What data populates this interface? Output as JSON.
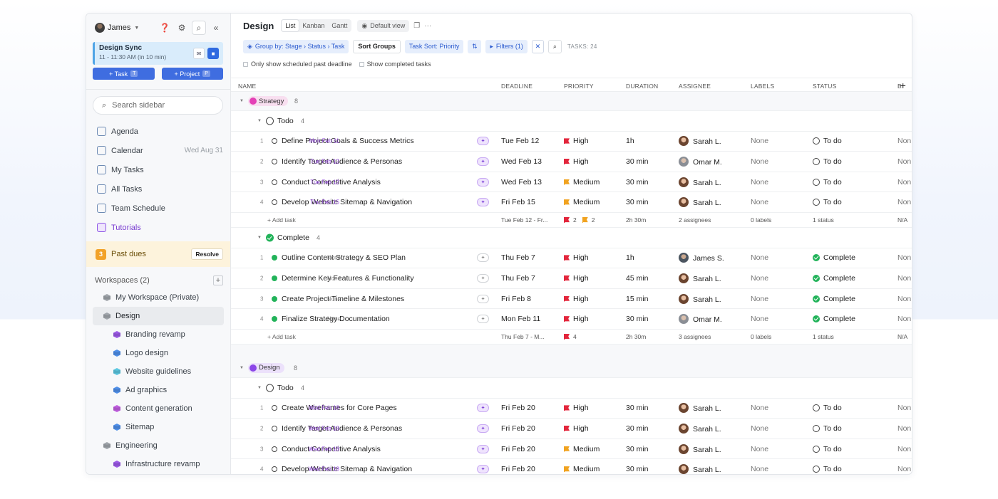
{
  "sidebar": {
    "user": "James",
    "meeting": {
      "title": "Design Sync",
      "time": "11 - 11:30 AM (in 10 min)"
    },
    "create": [
      {
        "label": "+ Task",
        "key": "T"
      },
      {
        "label": "+ Project",
        "key": "P"
      }
    ],
    "search_placeholder": "Search sidebar",
    "nav": [
      {
        "label": "Agenda",
        "value": ""
      },
      {
        "label": "Calendar",
        "value": "Wed Aug 31"
      },
      {
        "label": "My Tasks",
        "value": ""
      },
      {
        "label": "All Tasks",
        "value": ""
      },
      {
        "label": "Team Schedule",
        "value": ""
      },
      {
        "label": "Tutorials",
        "value": ""
      }
    ],
    "past_dues": {
      "count": "3",
      "label": "Past dues",
      "action": "Resolve"
    },
    "workspaces_title": "Workspaces (2)",
    "workspaces": [
      {
        "label": "My Workspace (Private)",
        "color": "#a0a5ab"
      },
      {
        "label": "Design",
        "color": "#a0a5ab"
      },
      {
        "label": "Branding revamp",
        "color": "#9d5be6"
      },
      {
        "label": "Logo design",
        "color": "#4f8fe8"
      },
      {
        "label": "Website guidelines",
        "color": "#5cc7e0"
      },
      {
        "label": "Ad graphics",
        "color": "#4f8fe8"
      },
      {
        "label": "Content generation",
        "color": "#c15ee0"
      },
      {
        "label": "Sitemap",
        "color": "#4f8fe8"
      },
      {
        "label": "Engineering",
        "color": "#a0a5ab"
      },
      {
        "label": "Infrastructure revamp",
        "color": "#9d5be6"
      }
    ]
  },
  "header": {
    "title": "Design",
    "views": [
      "List",
      "Kanban",
      "Gantt"
    ],
    "default_view": "Default view",
    "group_by": "Group by: Stage › Status › Task",
    "sort_groups": "Sort Groups",
    "task_sort": "Task Sort: Priority",
    "filters": "Filters (1)",
    "tasks_count": "TASKS: 24",
    "checkbox1": "Only show scheduled past deadline",
    "checkbox2": "Show completed tasks"
  },
  "columns": [
    "NAME",
    "DEADLINE",
    "PRIORITY",
    "DURATION",
    "ASSIGNEE",
    "LABELS",
    "STATUS",
    "B"
  ],
  "groups": {
    "strategy": {
      "label": "Strategy",
      "count": "8"
    },
    "design": {
      "label": "Design",
      "count": "8"
    }
  },
  "statuses": {
    "todo": {
      "label": "Todo",
      "count": "4"
    },
    "complete": {
      "label": "Complete",
      "count": "4"
    },
    "todo2": {
      "label": "Todo",
      "count": "4"
    }
  },
  "strategy_todo": [
    {
      "n": "1",
      "name": "Define Project Goals & Success Metrics",
      "sched": "Mon Feb 11",
      "deadline": "Tue Feb 12",
      "priority": "High",
      "duration": "1h",
      "assignee": "Sarah L.",
      "labels": "None",
      "status": "To do",
      "extra": "Non"
    },
    {
      "n": "2",
      "name": "Identify Target Audience & Personas",
      "sched": "Tue Feb 12",
      "deadline": "Wed Feb 13",
      "priority": "High",
      "duration": "30 min",
      "assignee": "Omar M.",
      "labels": "None",
      "status": "To do",
      "extra": "Non"
    },
    {
      "n": "3",
      "name": "Conduct Competitive Analysis",
      "sched": "Tue Feb 12",
      "deadline": "Wed Feb 13",
      "priority": "Medium",
      "duration": "30 min",
      "assignee": "Sarah L.",
      "labels": "None",
      "status": "To do",
      "extra": "Non"
    },
    {
      "n": "4",
      "name": "Develop Website Sitemap & Navigation",
      "sched": "Thu Feb 15",
      "deadline": "Fri Feb 15",
      "priority": "Medium",
      "duration": "30 min",
      "assignee": "Sarah L.",
      "labels": "None",
      "status": "To do",
      "extra": "Non"
    }
  ],
  "summary1": {
    "add": "+ Add task",
    "deadline": "Tue Feb 12 - Fr...",
    "high": "2",
    "medium": "2",
    "duration": "2h 30m",
    "assignees": "2 assignees",
    "labels": "0 labels",
    "status": "1 status",
    "extra": "N/A"
  },
  "strategy_complete": [
    {
      "n": "1",
      "name": "Outline Content Strategy & SEO Plan",
      "sched": "None",
      "deadline": "Thu Feb 7",
      "priority": "High",
      "duration": "1h",
      "assignee": "James S.",
      "labels": "None",
      "status": "Complete",
      "extra": "Non"
    },
    {
      "n": "2",
      "name": "Determine Key Features & Functionality",
      "sched": "None",
      "deadline": "Thu Feb 7",
      "priority": "High",
      "duration": "45 min",
      "assignee": "Sarah L.",
      "labels": "None",
      "status": "Complete",
      "extra": "Non"
    },
    {
      "n": "3",
      "name": "Create Project Timeline & Milestones",
      "sched": "None",
      "deadline": "Fri Feb 8",
      "priority": "High",
      "duration": "15 min",
      "assignee": "Sarah L.",
      "labels": "None",
      "status": "Complete",
      "extra": "Non"
    },
    {
      "n": "4",
      "name": "Finalize Strategy Documentation",
      "sched": "None",
      "deadline": "Mon Feb 11",
      "priority": "High",
      "duration": "30 min",
      "assignee": "Omar M.",
      "labels": "None",
      "status": "Complete",
      "extra": "Non"
    }
  ],
  "summary2": {
    "add": "+ Add task",
    "deadline": "Thu Feb 7 - M...",
    "high": "4",
    "duration": "2h 30m",
    "assignees": "3 assignees",
    "labels": "0 labels",
    "status": "1 status",
    "extra": "N/A"
  },
  "design_todo": [
    {
      "n": "1",
      "name": "Create Wireframes for Core Pages",
      "sched": "Wed Feb 18",
      "deadline": "Fri Feb 20",
      "priority": "High",
      "duration": "30 min",
      "assignee": "Sarah L.",
      "labels": "None",
      "status": "To do",
      "extra": "Non"
    },
    {
      "n": "2",
      "name": "Identify Target Audience & Personas",
      "sched": "Wed Feb 18",
      "deadline": "Fri Feb 20",
      "priority": "High",
      "duration": "30 min",
      "assignee": "Sarah L.",
      "labels": "None",
      "status": "To do",
      "extra": "Non"
    },
    {
      "n": "3",
      "name": "Conduct Competitive Analysis",
      "sched": "Wed Feb 18",
      "deadline": "Fri Feb 20",
      "priority": "Medium",
      "duration": "30 min",
      "assignee": "Sarah L.",
      "labels": "None",
      "status": "To do",
      "extra": "Non"
    },
    {
      "n": "4",
      "name": "Develop Website Sitemap & Navigation",
      "sched": "Wed Feb 18",
      "deadline": "Fri Feb 20",
      "priority": "Medium",
      "duration": "30 min",
      "assignee": "Sarah L.",
      "labels": "None",
      "status": "To do",
      "extra": "Non"
    }
  ]
}
